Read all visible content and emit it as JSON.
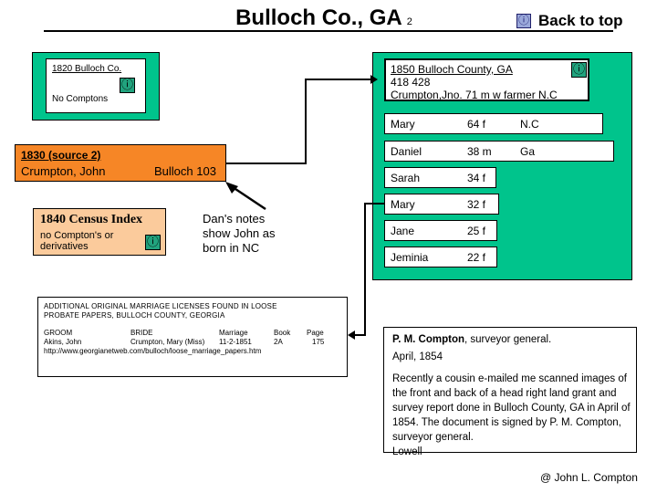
{
  "header": {
    "title": "Bulloch Co., GA",
    "title_sup": "2",
    "back_to_top": "Back to top",
    "back_to_top_icon": "info-icon"
  },
  "box_1820": {
    "heading": "1820 Bulloch Co.",
    "note": "No Comptons",
    "icon": "info-icon"
  },
  "box_1830": {
    "heading": "1830 (source 2)",
    "name": "Crumpton, John",
    "county_page": "Bulloch  103"
  },
  "box_1840": {
    "heading": "1840 Census Index",
    "line1": "no Compton's or",
    "line2": "derivatives",
    "icon": "info-icon"
  },
  "dan_notes": {
    "line1": "Dan's notes",
    "line2": "show John as",
    "line3": "born in NC"
  },
  "box_1850": {
    "heading": "1850 Bulloch County, GA",
    "dwelling_family": "418     428",
    "head_of_house": "Crumpton,Jno.   71 m w  farmer  N.C",
    "icon": "info-icon"
  },
  "family_rows": [
    {
      "name": "Mary",
      "age_sex": "64 f",
      "state": "N.C"
    },
    {
      "name": "Daniel",
      "age_sex": "38 m",
      "state": "Ga"
    },
    {
      "name": "Sarah",
      "age_sex": "34 f",
      "state": ""
    },
    {
      "name": "Mary",
      "age_sex": "32 f",
      "state": ""
    },
    {
      "name": "Jane",
      "age_sex": "25 f",
      "state": ""
    },
    {
      "name": "Jeminia",
      "age_sex": "22 f",
      "state": ""
    }
  ],
  "box_marriage": {
    "title_line1": "ADDITIONAL ORIGINAL MARRIAGE LICENSES FOUND IN LOOSE",
    "title_line2": "PROBATE PAPERS, BULLOCH COUNTY, GEORGIA",
    "header_groom": "GROOM",
    "header_bride": "BRIDE",
    "header_marriage": "Marriage",
    "header_book": "Book",
    "header_page": "Page",
    "row_groom": "Akins, John",
    "row_bride": "Crumpton, Mary (Miss)",
    "row_marriage": "11-2-1851",
    "row_book": "2A",
    "row_page": "175",
    "url": "http://www.georgianetweb.com/bulloch/loose_marriage_papers.htm"
  },
  "box_surveyor": {
    "name": "P. M. Compton",
    "title_suffix": ", surveyor general.",
    "date": "April, 1854",
    "body": "Recently a cousin e-mailed me scanned images of the front and back of a head right land grant and survey report done in Bulloch County, GA in April of 1854. The document is signed by P. M. Compton, surveyor general.",
    "signature": "Lowell"
  },
  "footer": {
    "credit": "@ John L. Compton"
  },
  "colors": {
    "green_panel": "#00c48c",
    "orange_1830": "#f68626",
    "orange_1840": "#fbcb9c",
    "icon_blue": "#9aa8da",
    "icon_green": "#21a37e",
    "line": "#000000"
  }
}
